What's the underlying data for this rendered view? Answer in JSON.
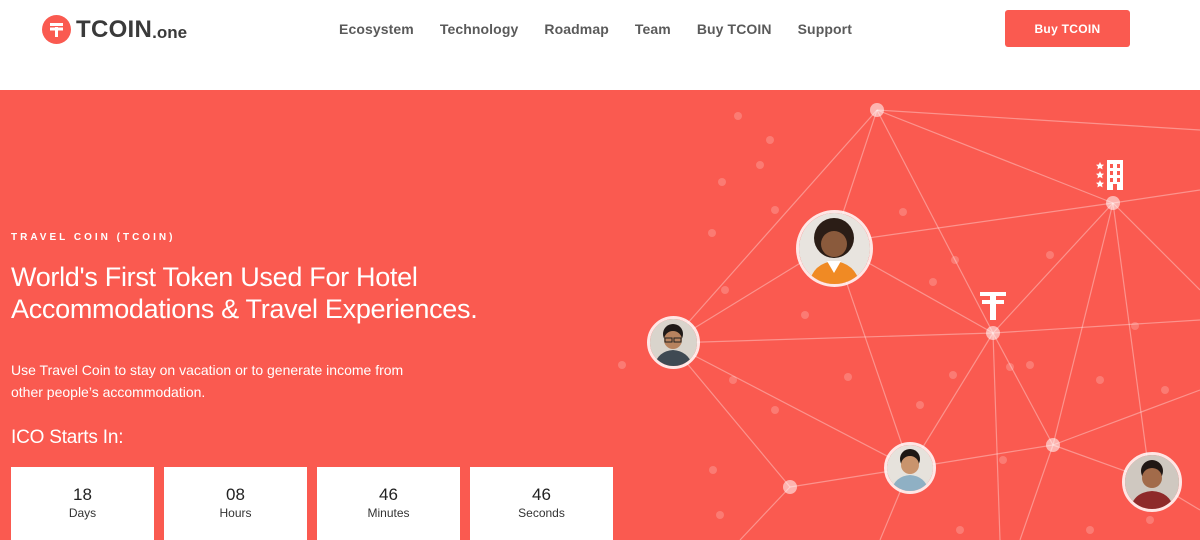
{
  "header": {
    "logo": {
      "main": "TCOIN",
      "suffix": ".one",
      "icon": "tcoin-logo-icon"
    },
    "nav": [
      "Ecosystem",
      "Technology",
      "Roadmap",
      "Team",
      "Buy TCOIN",
      "Support"
    ],
    "cta_label": "Buy TCOIN"
  },
  "hero": {
    "eyebrow": "TRAVEL COIN (TCOIN)",
    "headline_line1": "World's First Token Used For Hotel",
    "headline_line2": "Accommodations & Travel Experiences.",
    "subtext_line1": "Use Travel Coin to stay on vacation or to generate income from",
    "subtext_line2": "other people’s accommodation.",
    "ico_label": "ICO Starts In:",
    "countdown": [
      {
        "value": "18",
        "unit": "Days"
      },
      {
        "value": "08",
        "unit": "Hours"
      },
      {
        "value": "46",
        "unit": "Minutes"
      },
      {
        "value": "46",
        "unit": "Seconds"
      }
    ],
    "icons": [
      "hotel-building-icon",
      "tcoin-symbol-icon"
    ]
  },
  "colors": {
    "brand": "#fa5a50",
    "text_dark": "#3a3a3a",
    "nav_text": "#5a5a5a",
    "white": "#ffffff"
  }
}
